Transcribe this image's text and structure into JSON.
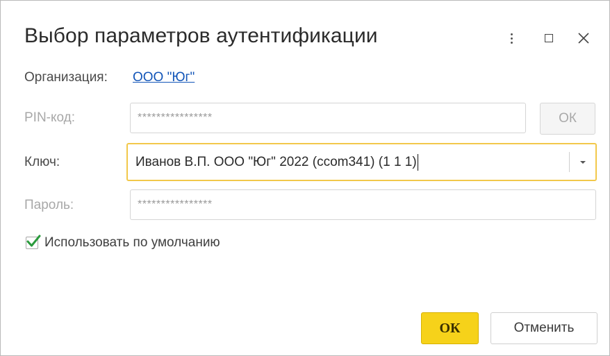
{
  "dialog": {
    "title": "Выбор параметров аутентификации"
  },
  "window_controls": {
    "more_icon": "more-vertical-icon",
    "maximize_icon": "maximize-icon",
    "close_icon": "close-icon"
  },
  "form": {
    "organization_label": "Организация:",
    "organization_value": "ООО \"Юг\"",
    "pin_label": "PIN-код:",
    "pin_value": "****************",
    "pin_ok_label": "ОК",
    "key_label": "Ключ:",
    "key_value": "Иванов В.П. ООО \"Юг\" 2022 (ccom341) (1 1 1)",
    "password_label": "Пароль:",
    "password_value": "****************",
    "use_default_label": "Использовать по умолчанию",
    "use_default_checked": true
  },
  "buttons": {
    "ok_label": "ОК",
    "cancel_label": "Отменить"
  },
  "colors": {
    "accent_yellow": "#f6d21a",
    "focus_border": "#f2c84a",
    "link": "#1255b8",
    "checkmark": "#2a9a3c"
  }
}
